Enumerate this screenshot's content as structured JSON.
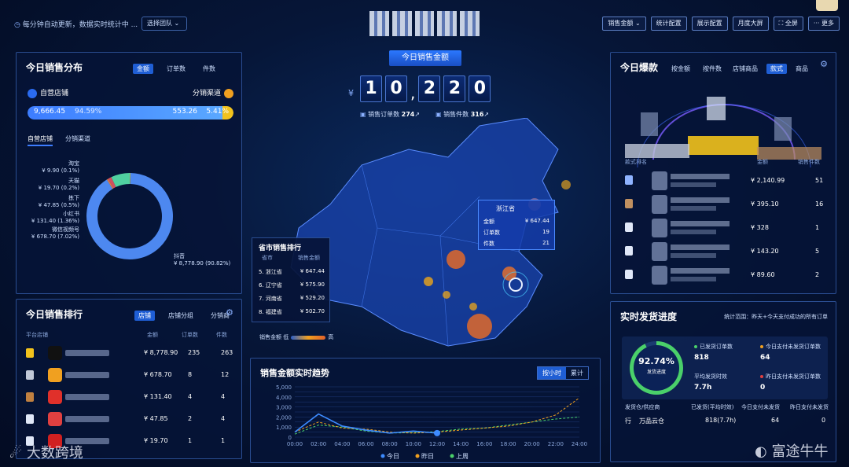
{
  "top": {
    "update_text": "每分钟自动更新，数据实时统计中 ...",
    "team_select": "选择团队",
    "buttons": [
      "销售金额",
      "统计配置",
      "展示配置",
      "月度大屏",
      "全屏",
      "更多"
    ]
  },
  "center": {
    "title": "今日销售金额",
    "currency": "¥",
    "digits": [
      "1",
      "0",
      "2",
      "2",
      "0"
    ],
    "orders_label": "销售订单数",
    "orders_value": "274",
    "items_label": "销售件数",
    "items_value": "316"
  },
  "dist": {
    "title": "今日销售分布",
    "tabs": [
      "金额",
      "订单数",
      "件数"
    ],
    "self_label": "自营店铺",
    "channel_label": "分销渠道",
    "self_value": "9,666.45",
    "self_pct": "94.59%",
    "channel_value": "553.26",
    "channel_pct": "5.41%",
    "self_share": 0.9459,
    "subtabs": [
      "自营店铺",
      "分销渠道"
    ],
    "segments": [
      {
        "name": "淘宝",
        "value": "¥ 9.90 (0.1%)",
        "pct": 0.1,
        "color": "#3ec8a0"
      },
      {
        "name": "天猫",
        "value": "¥ 19.70 (0.2%)",
        "pct": 0.2,
        "color": "#e0c040"
      },
      {
        "name": "抖音",
        "value": "¥ 8,778.90 (90.82%)",
        "pct": 90.82,
        "color": "#4d88f0"
      },
      {
        "name": "拣下",
        "value": "¥ 47.85 (0.5%)",
        "pct": 0.5,
        "color": "#e08040"
      },
      {
        "name": "小红书",
        "value": "¥ 131.40 (1.36%)",
        "pct": 1.36,
        "color": "#d05060"
      },
      {
        "name": "微信视频号",
        "value": "¥ 678.70 (7.02%)",
        "pct": 7.02,
        "color": "#50d0a0"
      }
    ]
  },
  "rank": {
    "title": "今日销售排行",
    "tabs": [
      "店铺",
      "店铺分组",
      "分销商"
    ],
    "headers": [
      "平台店铺",
      "金额",
      "订单数",
      "件数"
    ],
    "rows": [
      {
        "amount": "¥ 8,778.90",
        "orders": "235",
        "items": "263",
        "medal": "#f2c21c",
        "plat": "#111111",
        "plat_label": ""
      },
      {
        "amount": "¥ 678.70",
        "orders": "8",
        "items": "12",
        "medal": "#c0c8d8",
        "plat": "#f0a020",
        "plat_label": ""
      },
      {
        "amount": "¥ 131.40",
        "orders": "4",
        "items": "4",
        "medal": "#c08040",
        "plat": "#e0302a",
        "plat_label": "小红书"
      },
      {
        "amount": "¥ 47.85",
        "orders": "2",
        "items": "4",
        "medal": "#e0e8f8",
        "plat": "#e04040",
        "plat_label": "拣下"
      },
      {
        "amount": "¥ 19.70",
        "orders": "1",
        "items": "1",
        "medal": "#e0e8f8",
        "plat": "#d02020",
        "plat_label": "天猫"
      }
    ]
  },
  "map": {
    "tooltip_title": "浙江省",
    "tooltip_rows": [
      {
        "label": "金额",
        "value": "¥ 647.44"
      },
      {
        "label": "订单数",
        "value": "19"
      },
      {
        "label": "件数",
        "value": "21"
      }
    ],
    "legend_low": "低",
    "legend_high": "高",
    "legend_label": "销售金额"
  },
  "prov": {
    "title": "省市销售排行",
    "headers": [
      "省市",
      "销售金额"
    ],
    "rows": [
      {
        "name": "5. 浙江省",
        "value": "¥ 647.44"
      },
      {
        "name": "6. 辽宁省",
        "value": "¥ 575.90"
      },
      {
        "name": "7. 河南省",
        "value": "¥ 529.20"
      },
      {
        "name": "8. 福建省",
        "value": "¥ 502.70"
      }
    ]
  },
  "trend": {
    "title": "销售金额实时趋势",
    "tabs": [
      "按小时",
      "累计"
    ]
  },
  "chart_data": {
    "type": "line",
    "x": [
      "00:00",
      "02:00",
      "04:00",
      "06:00",
      "08:00",
      "10:00",
      "12:00",
      "14:00",
      "16:00",
      "18:00",
      "20:00",
      "22:00",
      "24:00"
    ],
    "ylim": [
      0,
      5000
    ],
    "yticks": [
      0,
      500,
      1000,
      1500,
      2000,
      2500,
      3000,
      3500,
      4000,
      4500,
      5000
    ],
    "series": [
      {
        "name": "今日",
        "color": "#3d8bff",
        "values": [
          500,
          2300,
          1100,
          700,
          400,
          600,
          400
        ]
      },
      {
        "name": "昨日",
        "color": "#f0a020",
        "values": [
          500,
          1500,
          900,
          800,
          500,
          400,
          500,
          700,
          900,
          1100,
          1500,
          2200,
          3900
        ]
      },
      {
        "name": "上周",
        "color": "#4ad06a",
        "values": [
          300,
          1200,
          1000,
          600,
          400,
          450,
          550,
          800,
          900,
          1200,
          1500,
          1800,
          2000
        ]
      }
    ]
  },
  "hot": {
    "title": "今日爆款",
    "mode_tabs": [
      "按金额",
      "按件数"
    ],
    "tabs": [
      "店铺商品",
      "款式",
      "商品"
    ],
    "headers": [
      "款式排名",
      "金额",
      "销售件数"
    ],
    "rows": [
      {
        "amount": "¥ 2,140.99",
        "count": "51",
        "icon": "#8fb3ff"
      },
      {
        "amount": "¥ 395.10",
        "count": "16",
        "icon": "#c09060"
      },
      {
        "amount": "¥ 328",
        "count": "1",
        "icon": "#e0e8f8"
      },
      {
        "amount": "¥ 143.20",
        "count": "5",
        "icon": "#e0e8f8"
      },
      {
        "amount": "¥ 89.60",
        "count": "2",
        "icon": "#e0e8f8"
      }
    ]
  },
  "ship": {
    "title": "实时发货进度",
    "range": "统计范围：昨天+今天支付成功的所有订单",
    "percent": "92.74%",
    "percent_label": "发货进度",
    "shipped_label": "已发货订单数",
    "shipped_value": "818",
    "unshipped_label": "今日支付未发货订单数",
    "unshipped_value": "64",
    "avg_label": "平均发货时效",
    "avg_value": "7.7h",
    "yest_label": "昨日支付未发货订单数",
    "yest_value": "0",
    "table_headers": [
      "发货仓/供应商",
      "已发货(平均时效)",
      "今日支付未发货",
      "昨日支付未发货"
    ],
    "row": {
      "rank": "行",
      "name": "万品云仓",
      "shipped": "818(7.7h)",
      "today": "64",
      "yest": "0"
    }
  },
  "watermarks": {
    "left": "大数跨境",
    "right": "富途牛牛"
  }
}
